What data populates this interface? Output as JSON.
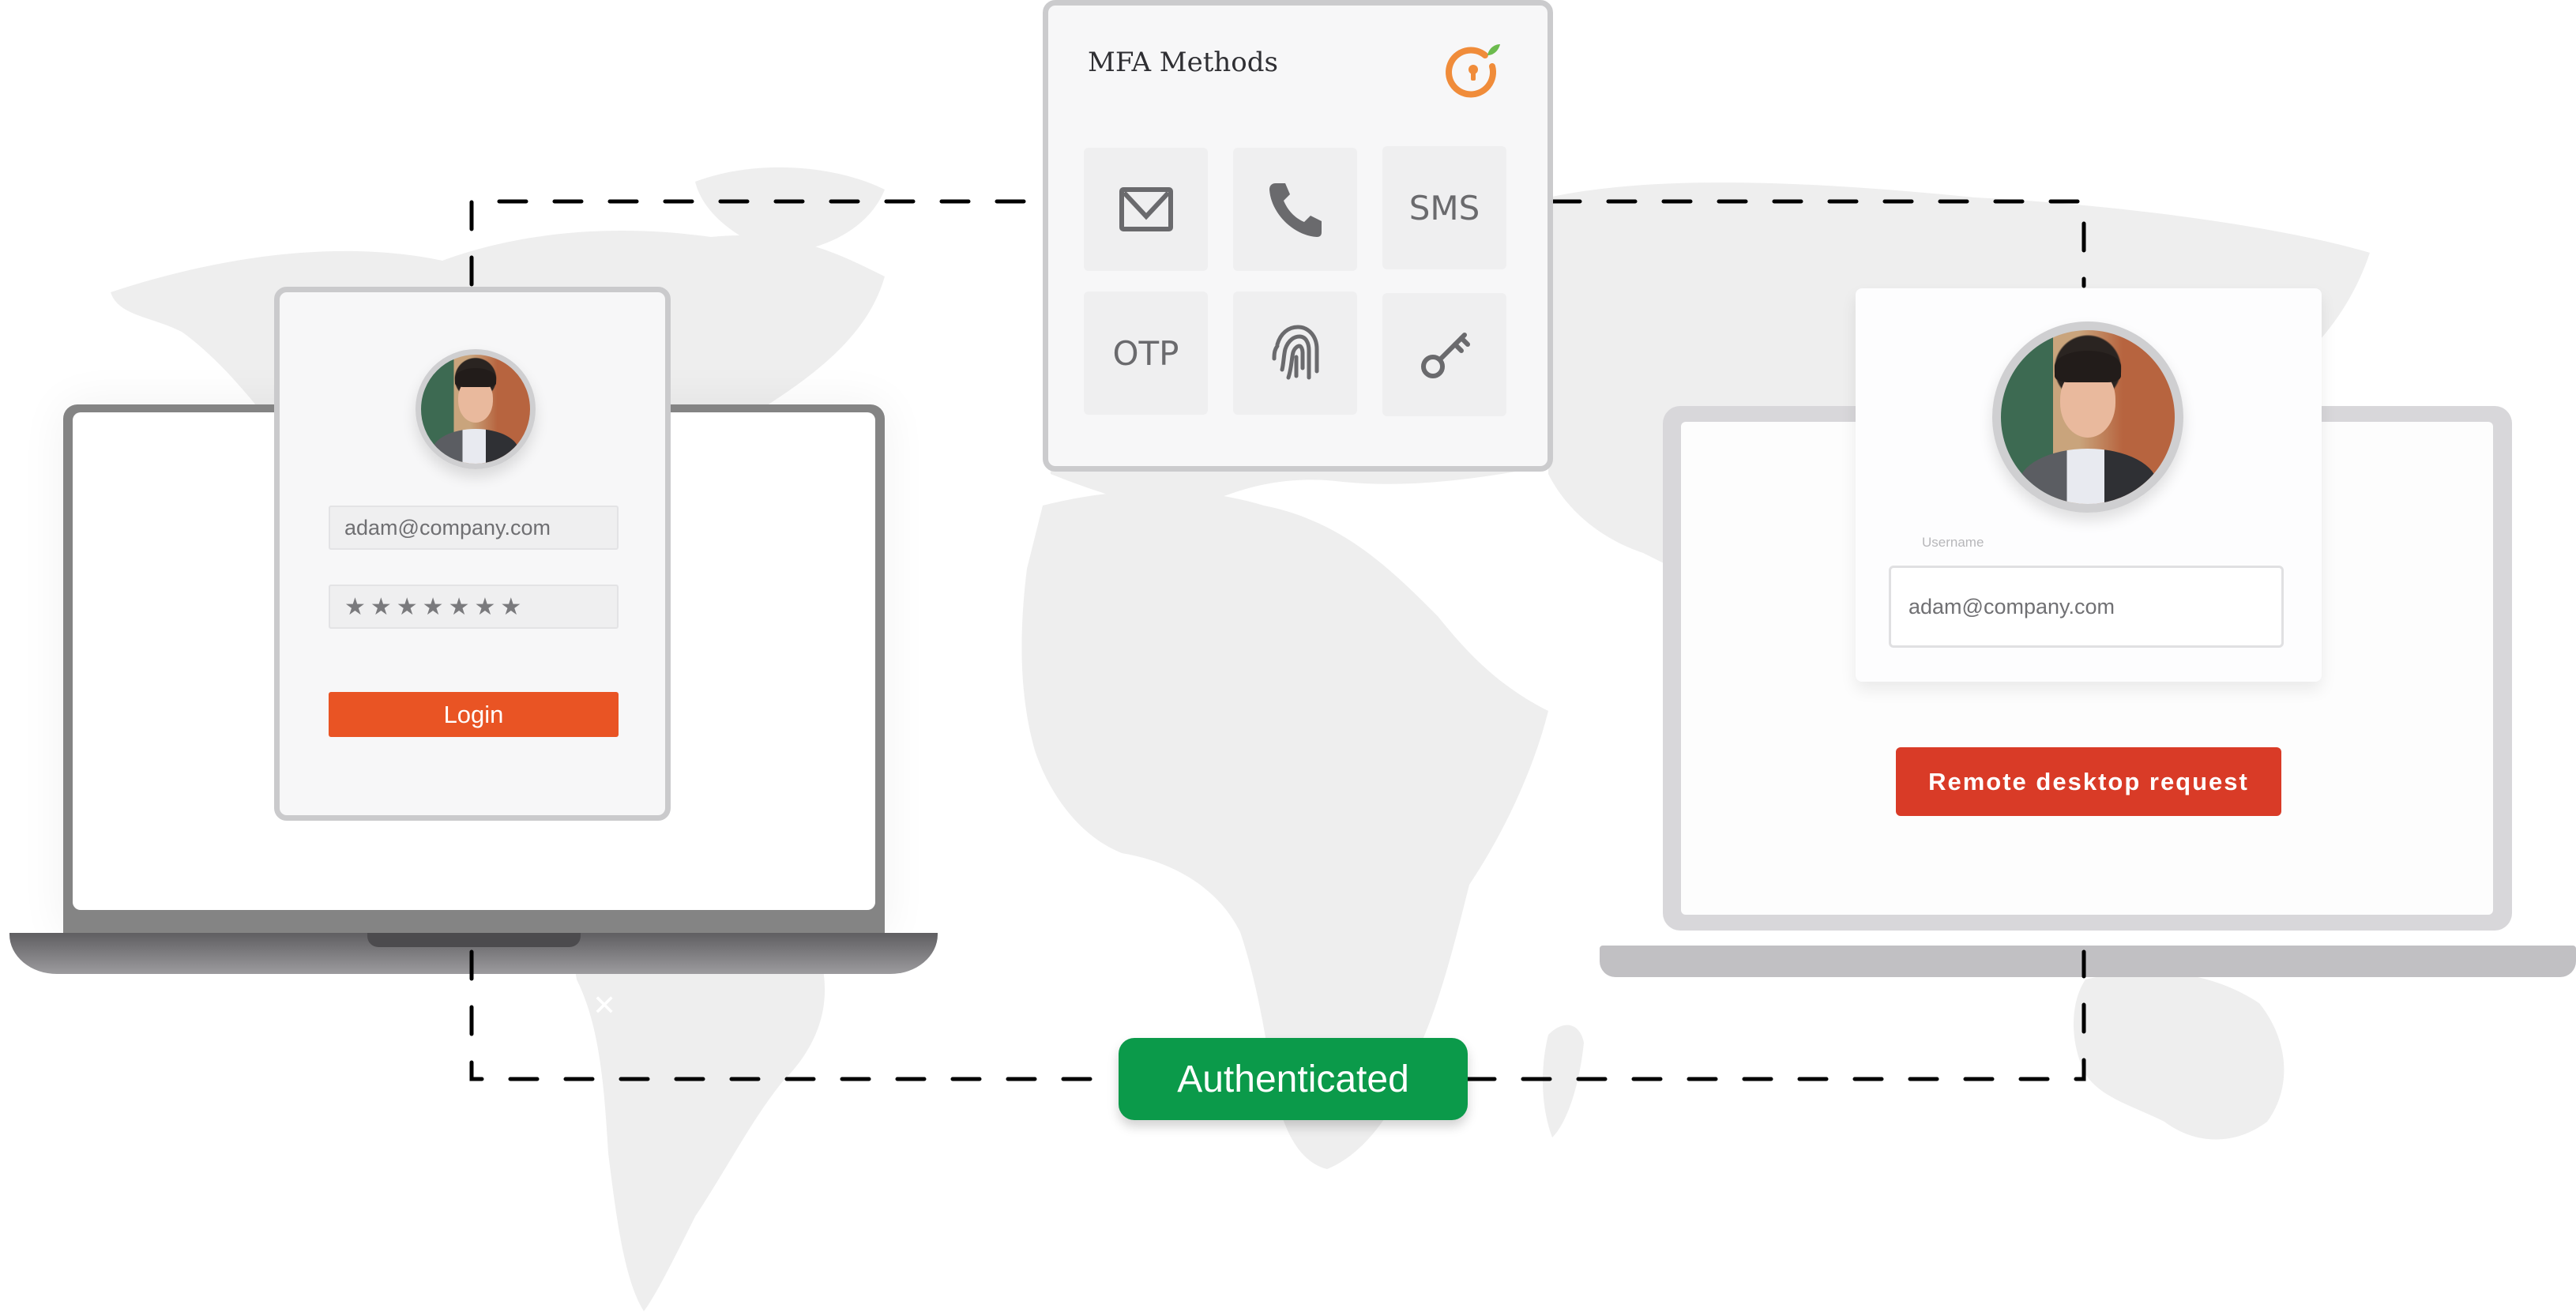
{
  "mfa_panel": {
    "title": "MFA Methods",
    "logo_icon": "orange-keyhole-logo-icon",
    "methods": [
      {
        "label": "Email",
        "icon": "envelope-icon",
        "text": ""
      },
      {
        "label": "Phone call",
        "icon": "phone-icon",
        "text": ""
      },
      {
        "label": "SMS",
        "icon": "",
        "text": "SMS"
      },
      {
        "label": "OTP",
        "icon": "",
        "text": "OTP"
      },
      {
        "label": "Biometric",
        "icon": "fingerprint-icon",
        "text": ""
      },
      {
        "label": "Hardware key",
        "icon": "key-icon",
        "text": ""
      }
    ]
  },
  "left_login": {
    "email_value": "adam@company.com",
    "password_value": "★★★★★★★",
    "login_label": "Login"
  },
  "remote_login": {
    "username_label": "Username",
    "username_value": "adam@company.com",
    "request_label": "Remote desktop request"
  },
  "status": {
    "label": "Authenticated"
  },
  "colors": {
    "login_button": "#e95424",
    "remote_button": "#d93b27",
    "authenticated": "#0b9a4a",
    "logo_orange": "#f08c3a",
    "logo_leaf": "#6cbb4e"
  }
}
